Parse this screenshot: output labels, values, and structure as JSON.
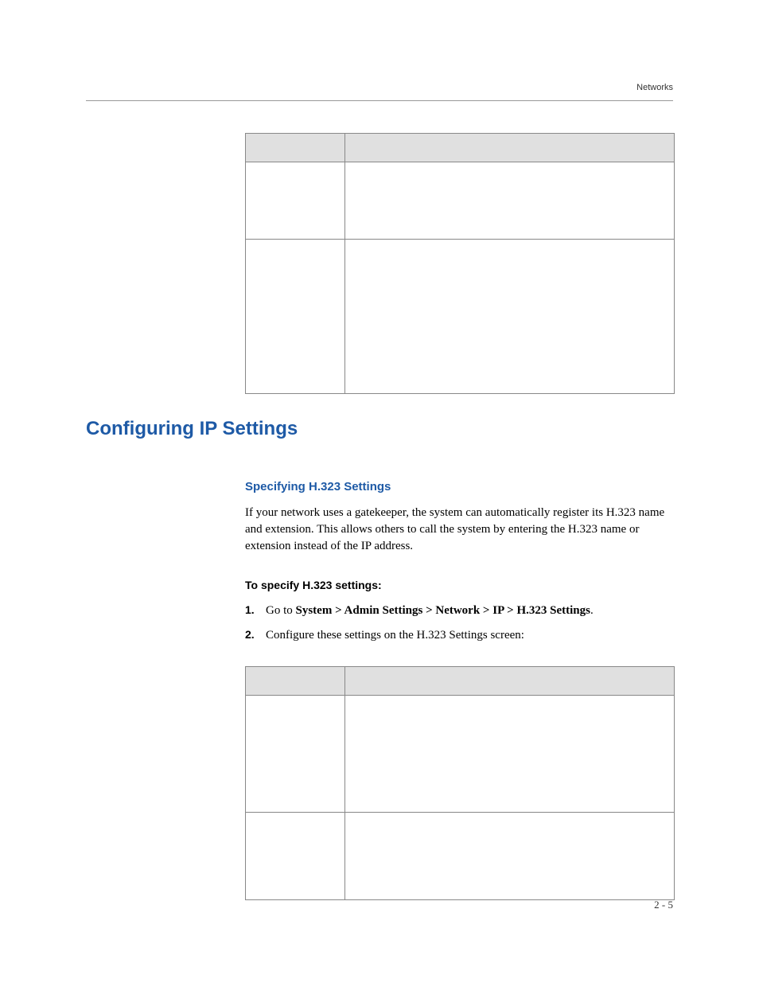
{
  "header": {
    "label": "Networks"
  },
  "table1": {
    "headers": {
      "col1": "",
      "col2": ""
    },
    "rows": [
      {
        "setting": "",
        "description": ""
      },
      {
        "setting": "",
        "description": ""
      }
    ]
  },
  "section": {
    "heading": "Configuring IP Settings",
    "sub1": {
      "heading": "Specifying H.323 Settings",
      "body": "If your network uses a gatekeeper, the system can automatically register its H.323 name and extension. This allows others to call the system by entering the H.323 name or extension instead of the IP address."
    },
    "steps": {
      "heading": "To specify H.323 settings:",
      "items": [
        {
          "num": "1.",
          "prefix": "Go to ",
          "bold": "System > Admin Settings > Network > IP > H.323 Settings",
          "suffix": "."
        },
        {
          "num": "2.",
          "text": "Configure these settings on the H.323 Settings screen:"
        }
      ]
    }
  },
  "table2": {
    "headers": {
      "col1": "",
      "col2": ""
    },
    "rows": [
      {
        "setting": "",
        "description": ""
      },
      {
        "setting": "",
        "description": ""
      }
    ]
  },
  "footer": {
    "page": "2 - 5"
  }
}
